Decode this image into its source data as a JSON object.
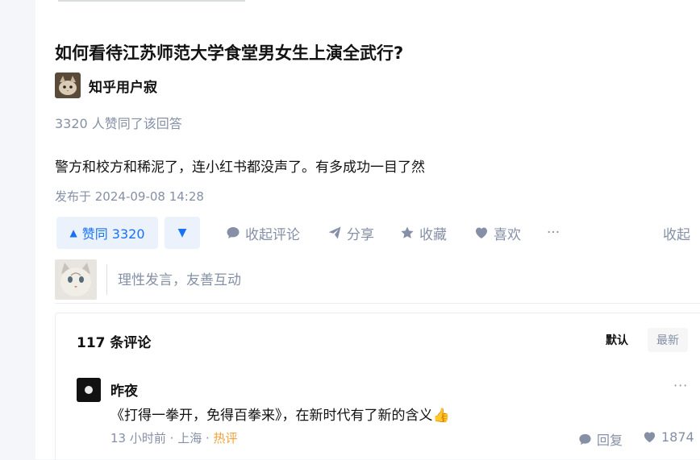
{
  "question": {
    "title": "如何看待江苏师范大学食堂男女生上演全武行?"
  },
  "answer": {
    "author": "知乎用户寂",
    "voters": "3320 人赞同了该回答",
    "content": "警方和校方和稀泥了，连小红书都没声了。有多成功一目了然",
    "published": "发布于 2024-09-08 14:28"
  },
  "actions": {
    "vote_up_label": "赞同 3320",
    "collapse_comments": "收起评论",
    "share": "分享",
    "favorite": "收藏",
    "like": "喜欢",
    "more": "···",
    "collapse": "收起"
  },
  "comment_input": {
    "placeholder": "理性发言，友善互动"
  },
  "comments": {
    "count_label": "117 条评论",
    "sort_default": "默认",
    "sort_latest": "最新",
    "items": [
      {
        "author": "昨夜",
        "text": "《打得一拳开，免得百拳来》，在新时代有了新的含义👍",
        "time": "13 小时前",
        "location": "上海",
        "tag": "热评",
        "reply_label": "回复",
        "likes": "1874",
        "more": "···"
      }
    ]
  }
}
